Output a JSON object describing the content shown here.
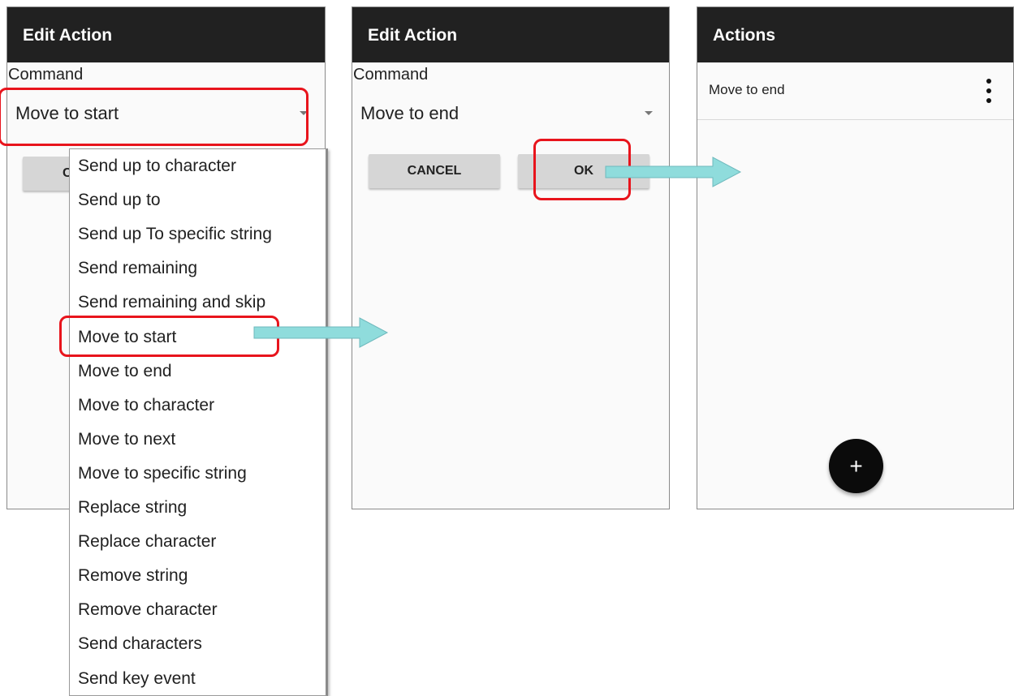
{
  "screen1": {
    "title": "Edit Action",
    "command_label": "Command",
    "selected": "Move to start",
    "cancel_partial": "C"
  },
  "menu": {
    "items": [
      "Send up to character",
      "Send up to",
      "Send up To specific string",
      "Send remaining",
      "Send remaining and skip",
      "Move to start",
      "Move to end",
      "Move to character",
      "Move to next",
      "Move to specific string",
      "Replace string",
      "Replace character",
      "Remove string",
      "Remove character",
      "Send characters",
      "Send key event"
    ]
  },
  "screen2": {
    "title": "Edit Action",
    "command_label": "Command",
    "selected": "Move to end",
    "cancel_label": "CANCEL",
    "ok_label": "OK"
  },
  "screen3": {
    "title": "Actions",
    "row_label": "Move to end",
    "fab_label": "+"
  },
  "colors": {
    "appbar": "#212121",
    "highlight": "#e8141c",
    "arrow": "#8fdcdc"
  },
  "icons": [
    "dropdown-arrow-icon",
    "more-vert-icon",
    "add-icon",
    "flow-arrow-icon"
  ]
}
